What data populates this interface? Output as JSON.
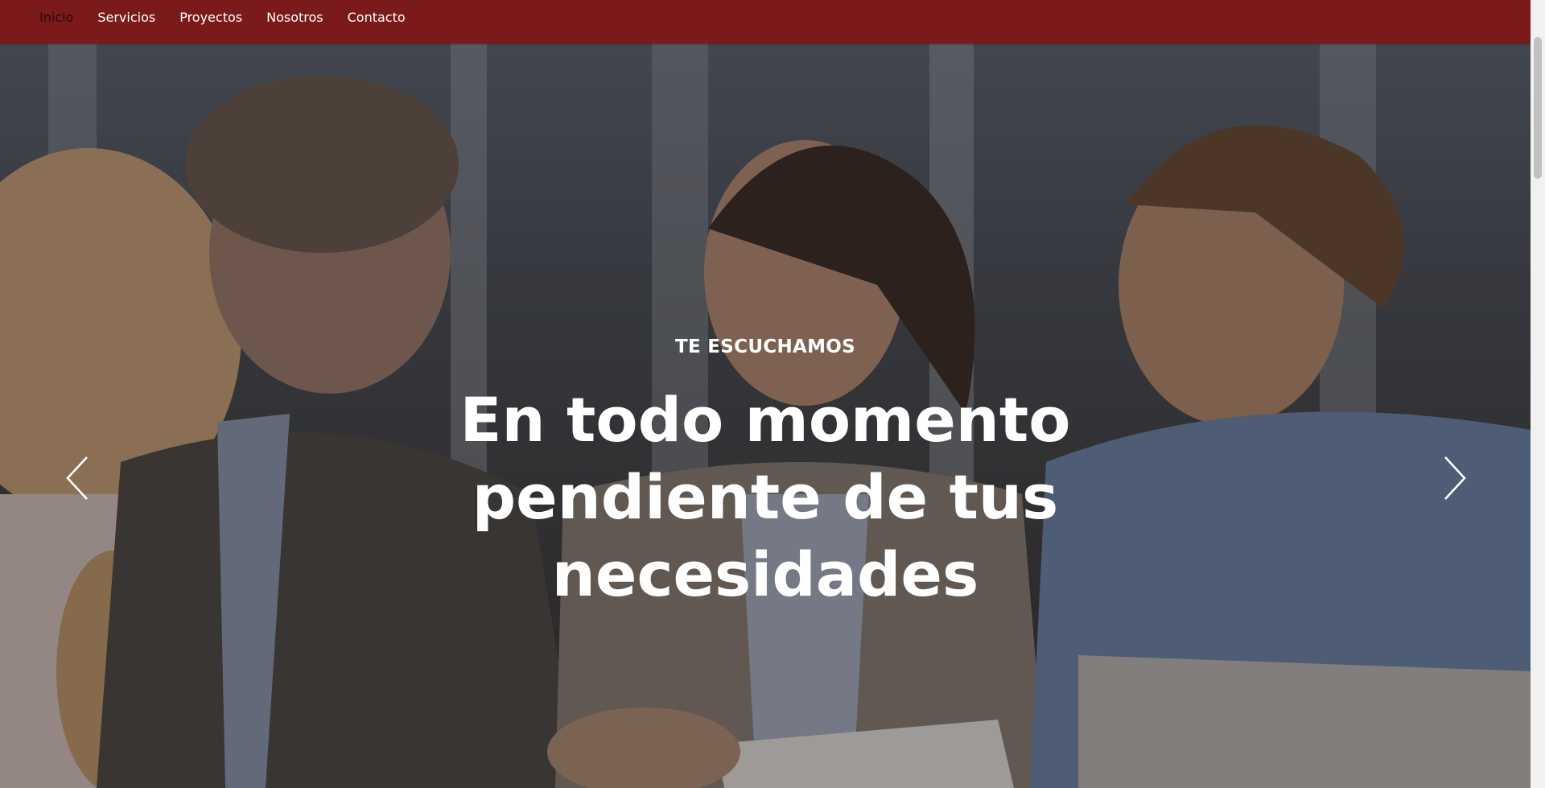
{
  "nav": {
    "items": [
      {
        "label": "Inicio",
        "active": true
      },
      {
        "label": "Servicios"
      },
      {
        "label": "Proyectos"
      },
      {
        "label": "Nosotros"
      },
      {
        "label": "Contacto"
      }
    ]
  },
  "hero": {
    "subheading": "TE ESCUCHAMOS",
    "heading": "En todo momento pendiente de tus necesidades",
    "prev_icon": "chevron-left-icon",
    "next_icon": "chevron-right-icon"
  },
  "colors": {
    "navbar": "#7b1a1a",
    "nav_text": "#ffffff",
    "nav_active": "#2a0808",
    "hero_text": "#ffffff"
  }
}
